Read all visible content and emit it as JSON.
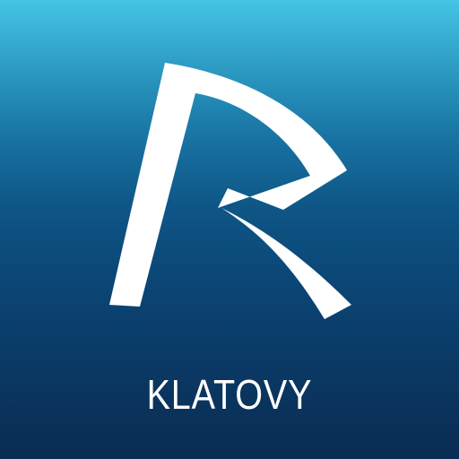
{
  "app": {
    "name": "KLATOVY",
    "logo_icon": "stylized-r-logo-icon",
    "colors": {
      "gradient_top": "#45c4e4",
      "gradient_bottom": "#0a2c52",
      "foreground": "#ffffff"
    }
  }
}
